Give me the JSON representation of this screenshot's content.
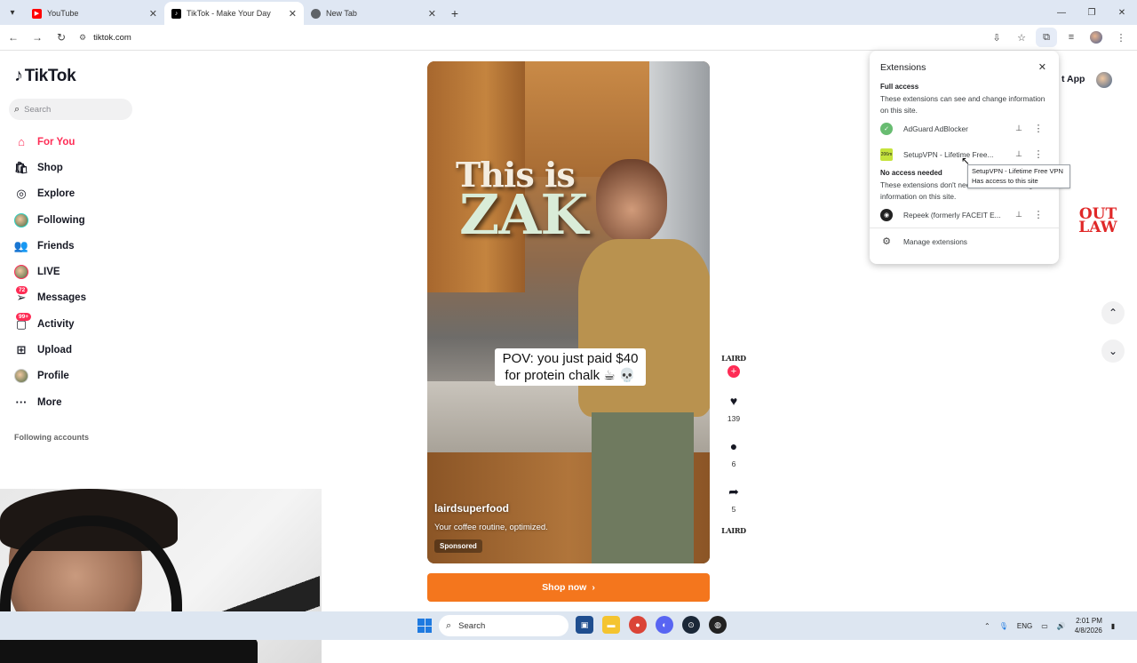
{
  "browser": {
    "tabs": [
      {
        "title": "YouTube",
        "favicon": "youtube-icon",
        "color": "#ff0000"
      },
      {
        "title": "TikTok - Make Your Day",
        "favicon": "tiktok-icon",
        "color": "#000000"
      },
      {
        "title": "New Tab",
        "favicon": "chrome-icon",
        "color": "#5f6368"
      }
    ],
    "url": "tiktok.com"
  },
  "tiktok": {
    "logo": "TikTok",
    "search_placeholder": "Search",
    "nav": [
      {
        "label": "For You",
        "icon": "home-icon"
      },
      {
        "label": "Shop",
        "icon": "shop-icon"
      },
      {
        "label": "Explore",
        "icon": "compass-icon"
      },
      {
        "label": "Following",
        "icon": "following-avatar"
      },
      {
        "label": "Friends",
        "icon": "friends-icon"
      },
      {
        "label": "LIVE",
        "icon": "live-avatar"
      },
      {
        "label": "Messages",
        "icon": "messages-icon",
        "badge": "72"
      },
      {
        "label": "Activity",
        "icon": "activity-icon",
        "badge": "99+"
      },
      {
        "label": "Upload",
        "icon": "upload-icon"
      },
      {
        "label": "Profile",
        "icon": "profile-avatar"
      },
      {
        "label": "More",
        "icon": "more-icon"
      }
    ],
    "following_accounts": "Following accounts",
    "get_app": "t App",
    "outlaw_text": "OUT LAW",
    "video": {
      "overlay_line1": "This is",
      "overlay_line2": "ZAK",
      "caption": "POV: you just paid $40 for protein chalk ☕ 💀",
      "username": "lairdsuperfood",
      "description": "Your coffee routine, optimized.",
      "sponsored": "Sponsored"
    },
    "shop_now": "Shop now",
    "actions": {
      "brand": "LAIRD",
      "likes": "139",
      "comments": "6",
      "shares": "5"
    }
  },
  "extensions_panel": {
    "title": "Extensions",
    "full_access_heading": "Full access",
    "full_access_desc": "These extensions can see and change information on this site.",
    "full_access_items": [
      {
        "name": "AdGuard AdBlocker",
        "icon": "adguard-shield-icon"
      },
      {
        "name": "SetupVPN - Lifetime Free...",
        "icon": "setupvpn-icon",
        "icon_text": "206m"
      }
    ],
    "no_access_heading": "No access needed",
    "no_access_desc": "These extensions don't need to see and change information on this site.",
    "no_access_items": [
      {
        "name": "Repeek (formerly FACEIT E...",
        "icon": "repeek-icon"
      }
    ],
    "manage": "Manage extensions",
    "tooltip_line1": "SetupVPN - Lifetime Free VPN",
    "tooltip_line2": "Has access to this site"
  },
  "taskbar": {
    "search": "Search",
    "lang": "ENG",
    "time": "2:01 PM",
    "date": "4/8/2026"
  }
}
